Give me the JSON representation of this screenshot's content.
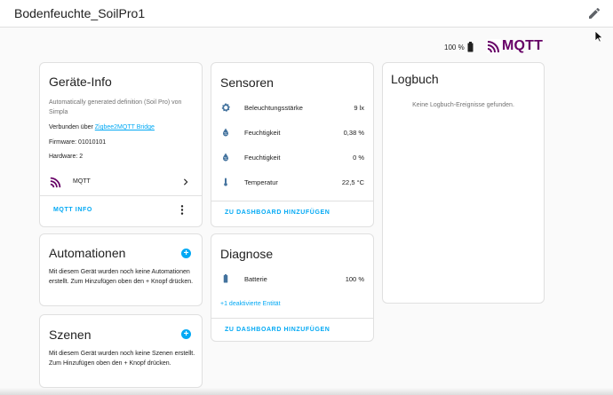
{
  "header": {
    "title": "Bodenfeuchte_SoilPro1",
    "icons": {
      "edit": "pencil-icon"
    }
  },
  "status": {
    "battery": "100 %",
    "brand": "MQTT"
  },
  "device_info": {
    "title": "Geräte-Info",
    "description": "Automatically generated definition (Soil Pro) von Simpla",
    "connected_prefix": "Verbunden über ",
    "connected_link": "Zigbee2MQTT Bridge",
    "firmware": "Firmware: 01010101",
    "hardware": "Hardware: 2",
    "integration": "MQTT",
    "action": "MQTT INFO"
  },
  "automations": {
    "title": "Automationen",
    "text": "Mit diesem Gerät wurden noch keine Automationen erstellt. Zum Hinzufügen oben den + Knopf drücken."
  },
  "scenes": {
    "title": "Szenen",
    "text": "Mit diesem Gerät wurden noch keine Szenen erstellt. Zum Hinzufügen oben den + Knopf drücken."
  },
  "sensors": {
    "title": "Sensoren",
    "items": [
      {
        "name": "Beleuchtungsstärke",
        "value": "9 lx",
        "icon": "brightness-icon"
      },
      {
        "name": "Feuchtigkeit",
        "value": "0,38 %",
        "icon": "water-percent-icon"
      },
      {
        "name": "Feuchtigkeit",
        "value": "0 %",
        "icon": "water-percent-icon"
      },
      {
        "name": "Temperatur",
        "value": "22,5 °C",
        "icon": "thermometer-icon"
      }
    ],
    "action": "ZU DASHBOARD HINZUFÜGEN"
  },
  "diagnostics": {
    "title": "Diagnose",
    "items": [
      {
        "name": "Batterie",
        "value": "100 %",
        "icon": "battery-icon"
      }
    ],
    "disabled_link": "+1 deaktivierte Entität",
    "action": "ZU DASHBOARD HINZUFÜGEN"
  },
  "logbook": {
    "title": "Logbuch",
    "empty": "Keine Logbuch-Ereignisse gefunden."
  },
  "colors": {
    "accent": "#03a9f4",
    "mqtt": "#660066",
    "icon": "#44739e"
  }
}
